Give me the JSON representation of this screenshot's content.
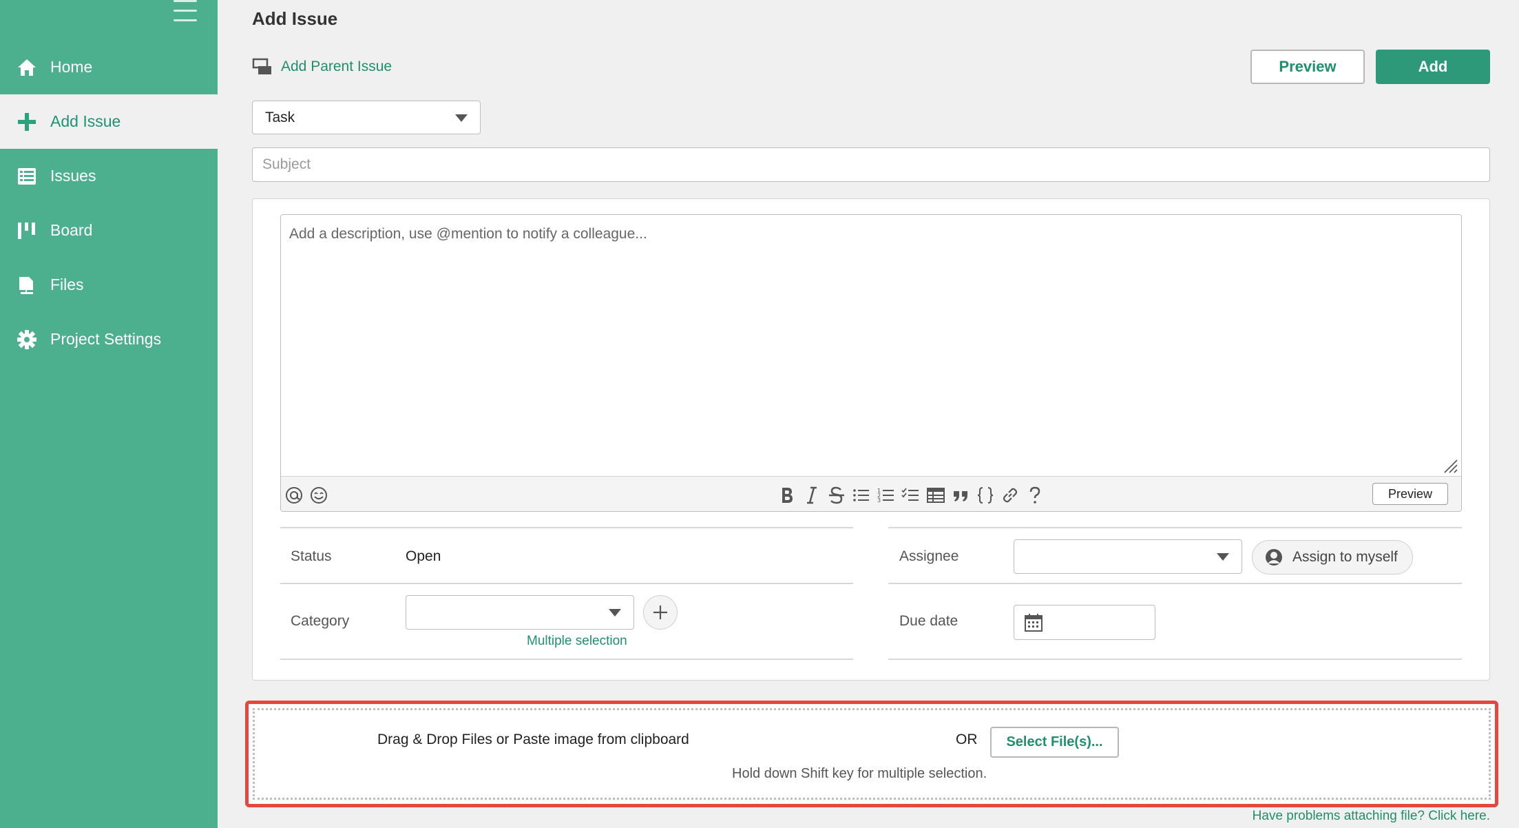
{
  "sidebar": {
    "items": [
      {
        "label": "Home",
        "icon": "home-icon"
      },
      {
        "label": "Add Issue",
        "icon": "plus-icon",
        "active": true
      },
      {
        "label": "Issues",
        "icon": "list-icon"
      },
      {
        "label": "Board",
        "icon": "board-icon"
      },
      {
        "label": "Files",
        "icon": "files-icon"
      },
      {
        "label": "Project Settings",
        "icon": "gear-icon"
      }
    ]
  },
  "header": {
    "title": "Add Issue",
    "parent_link": "Add Parent Issue",
    "preview_label": "Preview",
    "add_label": "Add"
  },
  "form": {
    "issue_type": "Task",
    "subject_placeholder": "Subject",
    "description_placeholder": "Add a description, use @mention to notify a colleague...",
    "toolbar_preview": "Preview",
    "status_label": "Status",
    "status_value": "Open",
    "assignee_label": "Assignee",
    "assignee_value": "",
    "assign_myself": "Assign to myself",
    "category_label": "Category",
    "category_value": "",
    "multiple_selection": "Multiple selection",
    "due_date_label": "Due date"
  },
  "attachments": {
    "drop_text": "Drag & Drop Files or Paste image from clipboard",
    "or_text": "OR",
    "select_files": "Select File(s)...",
    "hint": "Hold down Shift key for multiple selection.",
    "problems_link": "Have problems attaching file? Click here."
  },
  "colors": {
    "sidebar_bg": "#4caf8e",
    "accent": "#1f8f6c",
    "add_button": "#2e9978",
    "highlight_border": "#e2483c"
  }
}
